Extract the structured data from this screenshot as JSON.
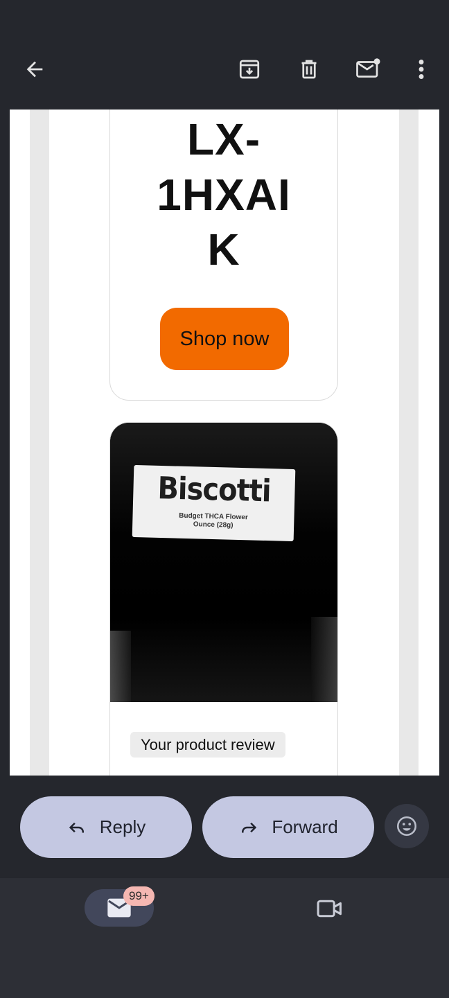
{
  "toolbar": {
    "back_icon": "arrow-left-icon",
    "archive_icon": "archive-icon",
    "delete_icon": "trash-icon",
    "mark_unread_icon": "mark-unread-icon",
    "more_icon": "more-vertical-icon"
  },
  "email": {
    "promo_code_lines": [
      "LX-",
      "1HXAI",
      "K"
    ],
    "shop_button_label": "Shop now",
    "shop_button_color": "#f26a00",
    "product_label_title": "Biscotti",
    "product_label_subtitle_1": "Budget THCA Flower",
    "product_label_subtitle_2": "Ounce (28g)",
    "review_tag": "Your product review"
  },
  "actions": {
    "reply_label": "Reply",
    "forward_label": "Forward",
    "emoji_icon": "emoji-icon",
    "pill_color": "#c4c8e2"
  },
  "bottom_nav": {
    "mail_icon": "mail-icon",
    "mail_badge": "99+",
    "meet_icon": "video-icon"
  }
}
